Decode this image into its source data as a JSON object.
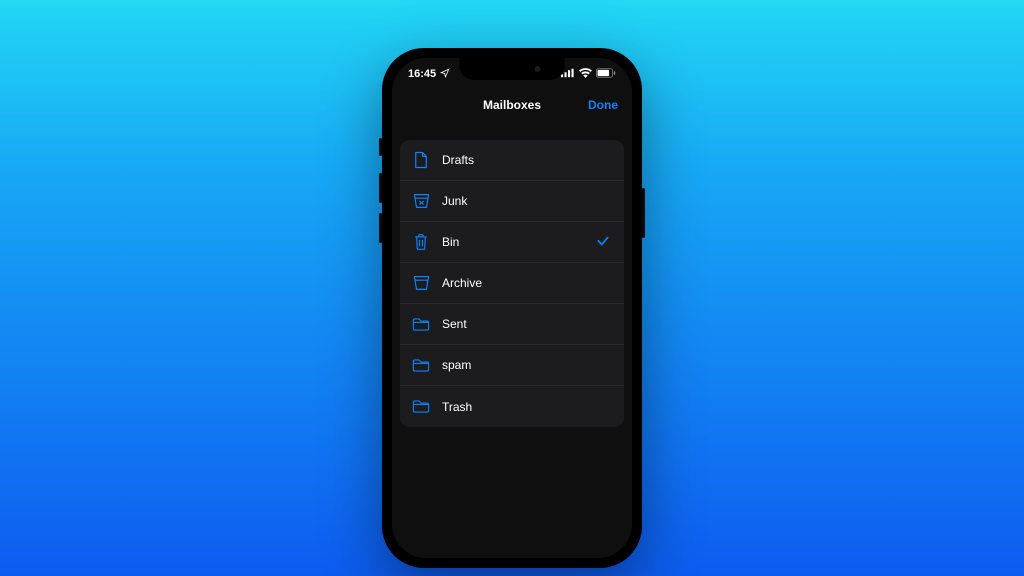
{
  "status": {
    "time": "16:45"
  },
  "nav": {
    "title": "Mailboxes",
    "done": "Done"
  },
  "mailboxes": {
    "items": [
      {
        "label": "Drafts",
        "icon": "doc-icon",
        "checked": false
      },
      {
        "label": "Junk",
        "icon": "junk-icon",
        "checked": false
      },
      {
        "label": "Bin",
        "icon": "trash-icon",
        "checked": true
      },
      {
        "label": "Archive",
        "icon": "archive-icon",
        "checked": false
      },
      {
        "label": "Sent",
        "icon": "folder-icon",
        "checked": false
      },
      {
        "label": "spam",
        "icon": "folder-icon",
        "checked": false
      },
      {
        "label": "Trash",
        "icon": "folder-icon",
        "checked": false
      }
    ]
  },
  "colors": {
    "accent": "#0a84ff"
  }
}
